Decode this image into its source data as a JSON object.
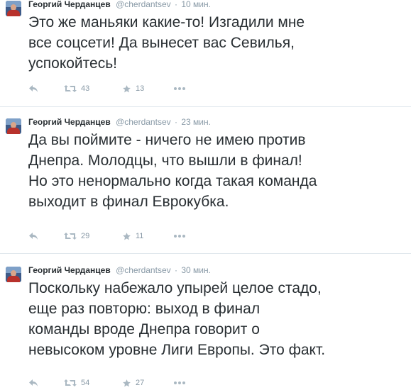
{
  "tweets": [
    {
      "author": "Георгий Черданцев",
      "handle": "@cherdantsev",
      "time": "10 мин.",
      "text": "Это же маньяки какие-то! Изгадили мне\nвсе соцсети! Да вынесет вас Севилья,\nуспокойтесь!",
      "retweets": "43",
      "favorites": "13"
    },
    {
      "author": "Георгий Черданцев",
      "handle": "@cherdantsev",
      "time": "23 мин.",
      "text": "Да вы поймите - ничего не имею против\nДнепра. Молодцы, что вышли в финал!\nНо это ненормально когда такая команда\nвыходит в финал Еврокубка.",
      "retweets": "29",
      "favorites": "11"
    },
    {
      "author": "Георгий Черданцев",
      "handle": "@cherdantsev",
      "time": "30 мин.",
      "text": "Поскольку набежало упырей целое стадо,\nеще раз повторю: выход в финал\nкоманды вроде Днепра говорит о\nневысоком уровне Лиги Европы. Это факт.",
      "retweets": "54",
      "favorites": "27"
    }
  ],
  "separator": "·",
  "icons": {
    "reply": "reply-icon",
    "retweet": "retweet-icon",
    "favorite": "star-icon",
    "more": "more-icon"
  },
  "colors": {
    "text": "#292f33",
    "meta": "#8899a6",
    "divider": "#e1e8ed"
  }
}
